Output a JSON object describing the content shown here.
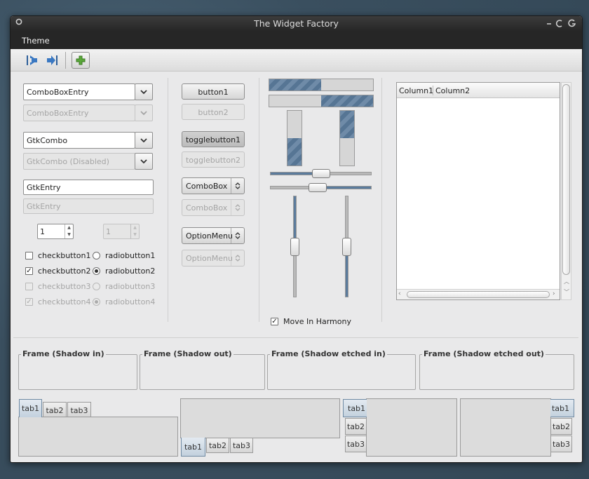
{
  "window": {
    "title": "The Widget Factory",
    "menu": [
      "Theme"
    ]
  },
  "icons": {
    "window_menu": "circle-icon",
    "minimize": "minimize-icon",
    "maximize": "restore-icon",
    "close": "close-icon",
    "goto_first": "goto-first-icon",
    "goto_last": "goto-last-icon",
    "add": "add-icon"
  },
  "colors": {
    "accent": "#5b7b9c",
    "add_icon": "#5aa83a"
  },
  "col1": {
    "comboboxentry": "ComboBoxEntry",
    "comboboxentry_disabled": "ComboBoxEntry",
    "gtkcombo": "GtkCombo",
    "gtkcombo_disabled": "GtkCombo (Disabled)",
    "entry": "GtkEntry",
    "entry_disabled": "GtkEntry",
    "spin1": "1",
    "spin2": "1",
    "check1": "checkbutton1",
    "check2": "checkbutton2",
    "check3": "checkbutton3",
    "check4": "checkbutton4",
    "radio1": "radiobutton1",
    "radio2": "radiobutton2",
    "radio3": "radiobutton3",
    "radio4": "radiobutton4",
    "check_states": [
      false,
      true,
      false,
      true
    ],
    "radio_states": [
      false,
      true,
      false,
      true
    ]
  },
  "col2": {
    "button1": "button1",
    "button2": "button2",
    "toggle1": "togglebutton1",
    "toggle2": "togglebutton2",
    "combobox1": "ComboBox",
    "combobox2": "ComboBox",
    "optionmenu1": "OptionMenu",
    "optionmenu2": "OptionMenu"
  },
  "col3": {
    "progress_h1": 0.5,
    "progress_h2": 0.5,
    "progress_v1": 0.5,
    "progress_v2": 0.5,
    "hscale1": 0.5,
    "hscale2": 0.5,
    "vscale1": 0.5,
    "vscale2": 0.5,
    "harmony_label": "Move In Harmony",
    "harmony_checked": true
  },
  "tree": {
    "columns": [
      "Column1",
      "Column2"
    ]
  },
  "frames": [
    "Frame (Shadow in)",
    "Frame (Shadow out)",
    "Frame (Shadow etched in)",
    "Frame (Shadow etched out)"
  ],
  "notebooks": {
    "top": [
      "tab1",
      "tab2",
      "tab3"
    ],
    "bottom": [
      "tab1",
      "tab2",
      "tab3"
    ],
    "left": [
      "tab1",
      "tab2",
      "tab3"
    ],
    "right": [
      "tab1",
      "tab2",
      "tab3"
    ]
  }
}
